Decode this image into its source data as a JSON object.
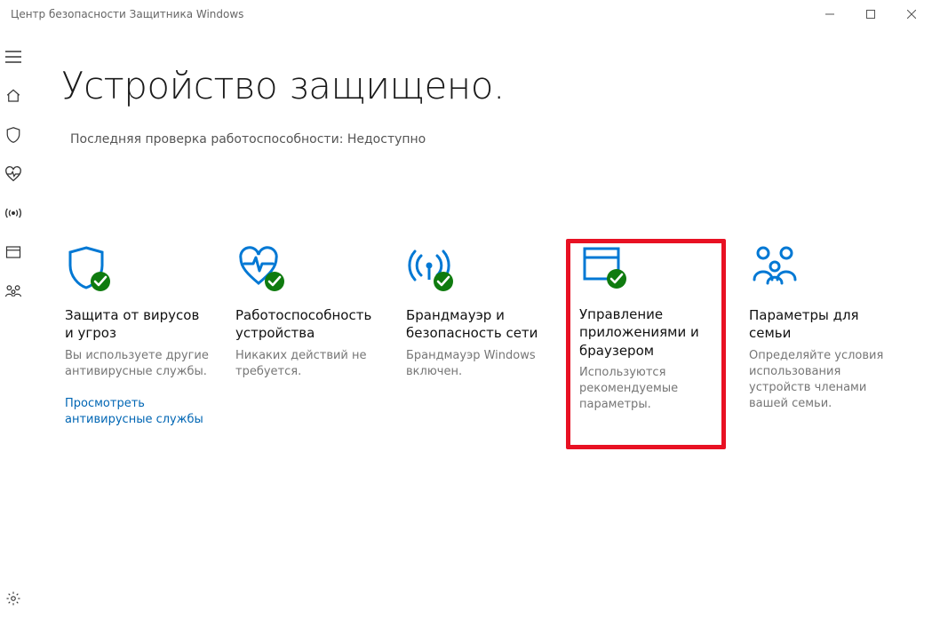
{
  "window": {
    "title": "Центр безопасности Защитника Windows"
  },
  "header": {
    "headline": "Устройство защищено.",
    "subline": "Последняя проверка работоспособности: Недоступно"
  },
  "tiles": [
    {
      "icon": "shield-check-icon",
      "title": "Защита от вирусов и угроз",
      "desc": "Вы используете другие антивирусные службы.",
      "link": "Просмотреть антивирусные службы",
      "highlighted": false
    },
    {
      "icon": "heart-pulse-check-icon",
      "title": "Работоспособность устройства",
      "desc": "Никаких действий не требуется.",
      "link": "",
      "highlighted": false
    },
    {
      "icon": "broadcast-check-icon",
      "title": "Брандмауэр и безопасность сети",
      "desc": "Брандмауэр Windows включен.",
      "link": "",
      "highlighted": false
    },
    {
      "icon": "window-check-icon",
      "title": "Управление приложениями и браузером",
      "desc": "Используются рекомендуемые параметры.",
      "link": "",
      "highlighted": true
    },
    {
      "icon": "family-icon",
      "title": "Параметры для семьи",
      "desc": "Определяйте условия использования устройств членами вашей семьи.",
      "link": "",
      "highlighted": false
    }
  ],
  "colors": {
    "accent": "#0078d4",
    "ok": "#0f7b0f",
    "highlight": "#e81123"
  }
}
